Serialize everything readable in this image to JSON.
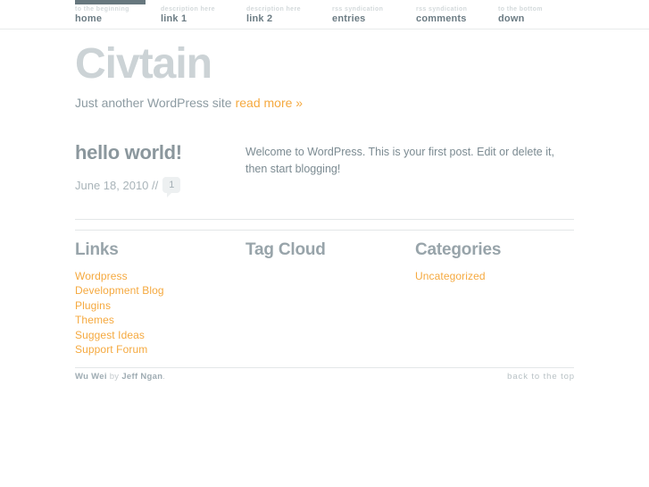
{
  "nav": {
    "active_index": 0,
    "items": [
      {
        "desc": "to the beginning",
        "label": "home"
      },
      {
        "desc": "description here",
        "label": "link 1"
      },
      {
        "desc": "description here",
        "label": "link 2"
      },
      {
        "desc": "rss syndication",
        "label": "entries"
      },
      {
        "desc": "rss syndication",
        "label": "comments"
      },
      {
        "desc": "to the bottom",
        "label": "down"
      }
    ]
  },
  "header": {
    "site_title": "Civtain",
    "tagline": "Just another WordPress site",
    "read_more_label": "read more »"
  },
  "post": {
    "title": "hello world!",
    "date": "June 18, 2010 //",
    "comment_count": "1",
    "excerpt": "Welcome to WordPress. This is your first post. Edit or delete it, then start blogging!"
  },
  "widgets": {
    "links": {
      "title": "Links",
      "items": [
        "Wordpress",
        "Development Blog",
        "Plugins",
        "Themes",
        "Suggest Ideas",
        "Support Forum"
      ]
    },
    "tag_cloud": {
      "title": "Tag Cloud",
      "items": []
    },
    "categories": {
      "title": "Categories",
      "items": [
        "Uncategorized"
      ]
    }
  },
  "footer": {
    "theme_name": "Wu Wei",
    "by_label": "by",
    "author": "Jeff Ngan",
    "period": ".",
    "back_to_top": "back to the top"
  },
  "colors": {
    "accent_orange": "#f5a93f",
    "nav_active_bar": "#67777e",
    "title_gray": "#ccd3d6",
    "rule_gray": "#e3e7e8"
  }
}
